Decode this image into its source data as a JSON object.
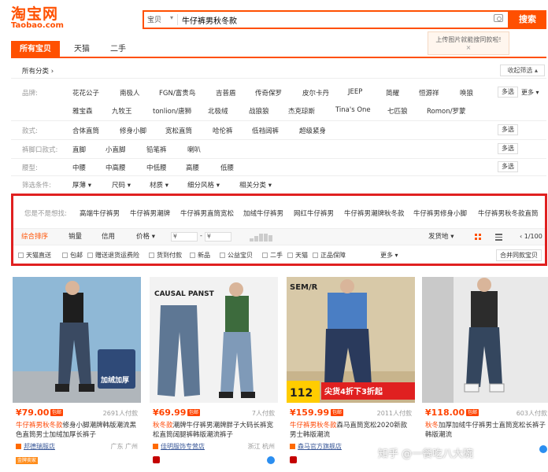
{
  "logo": {
    "cn": "淘宝网",
    "en": "Taobao.com"
  },
  "search": {
    "scope": "宝贝",
    "query": "牛仔裤男秋冬款",
    "button": "搜索"
  },
  "tooltip": {
    "text": "上传图片就能搜同款啦!",
    "close": "×"
  },
  "tabs": [
    {
      "label": "所有宝贝"
    },
    {
      "label": "天猫"
    },
    {
      "label": "二手"
    }
  ],
  "crumb": {
    "label": "所有分类",
    "collapse": "收起筛选"
  },
  "brand_row": {
    "label": "品牌:",
    "values": [
      "花花公子",
      "南极人",
      "FGN/富贵鸟",
      "吉普盾",
      "传奇保罗",
      "皮尔卡丹",
      "JEEP",
      "简耀",
      "恒源祥",
      "唤狼",
      "雅宝森",
      "九牧王",
      "tonlion/唐狮",
      "北极绒",
      "战狼狼",
      "杰克琼斯",
      "Tina's One",
      "七匹狼",
      "Romon/罗蒙"
    ],
    "multi": "多选",
    "more": "更多"
  },
  "style_row": {
    "label": "款式:",
    "values": [
      "合体直筒",
      "修身小脚",
      "宽松直筒",
      "哈伦裤",
      "低裆阔裤",
      "超级紧身"
    ],
    "multi": "多选"
  },
  "leg_row": {
    "label": "裤脚口款式:",
    "values": [
      "直脚",
      "小直脚",
      "铅笔裤",
      "喇叭"
    ],
    "multi": "多选"
  },
  "waist_row": {
    "label": "腰型:",
    "values": [
      "中腰",
      "中高腰",
      "中低腰",
      "高腰",
      "低腰"
    ],
    "multi": "多选"
  },
  "cond_row": {
    "label": "筛选条件:",
    "values": [
      "厚薄",
      "尺码",
      "材质",
      "细分风格",
      "相关分类"
    ]
  },
  "guess": {
    "label": "您是不是想找:",
    "values": [
      "高端牛仔裤男",
      "牛仔裤男潮牌",
      "牛仔裤男直筒宽松",
      "加绒牛仔裤男",
      "网红牛仔裤男",
      "牛仔裤男潮牌秋冬款",
      "牛仔裤男修身小脚",
      "牛仔裤男秋冬款直筒"
    ]
  },
  "sortbar": {
    "items": [
      "综合排序",
      "销量",
      "信用",
      "价格"
    ],
    "price_from": "¥",
    "price_to": "¥",
    "dash": "-",
    "ship": "发货地",
    "page": "1/100"
  },
  "options": {
    "values": [
      "天猫直送",
      "包邮",
      "赠送退货运费险",
      "货到付款",
      "新品",
      "公益宝贝",
      "二手",
      "天猫",
      "正品保障"
    ],
    "more": "更多",
    "combine": "合并同款宝贝"
  },
  "products": [
    {
      "price": "¥79.00",
      "badge": "包邮",
      "sold": "2691人付款",
      "title_hl": "牛仔裤男秋冬款",
      "title_rest": "修身小脚潮牌韩版潮流黑色直筒男士加绒加厚长裤子",
      "shop": "邦德瑞服店",
      "loc": "广东 广州",
      "gold": "金牌卖家"
    },
    {
      "price": "¥69.99",
      "badge": "包邮",
      "sold": "7人付款",
      "title_hl": "秋冬款",
      "title_rest": "潮牌牛仔裤男潮牌胖子大码长裤宽松直筒阔腿裤韩版潮流裤子",
      "shop": "佳明服饰专营店",
      "loc": "浙江 杭州",
      "gold": ""
    },
    {
      "price": "¥159.99",
      "badge": "包邮",
      "sold": "2011人付款",
      "title_hl": "牛仔裤男秋冬款",
      "title_rest": "森马直筒宽松2020新款男士韩版潮流",
      "shop": "森马官方旗舰店",
      "loc": "",
      "gold": "",
      "img_text": {
        "brand": "SEM/R",
        "num": "112",
        "deal": "尖货4折下3折起"
      }
    },
    {
      "price": "¥118.00",
      "badge": "包邮",
      "sold": "603人付款",
      "title_hl": "秋冬",
      "title_rest": "加厚加绒牛仔裤男士直筒宽松长裤子韩版潮流",
      "shop": "",
      "loc": "",
      "gold": ""
    }
  ],
  "product2_img": {
    "label": "CAUSAL PANST"
  },
  "product1_img": {
    "label": "加绒加厚"
  },
  "watermark": "知乎 @一餐吃八大碗"
}
